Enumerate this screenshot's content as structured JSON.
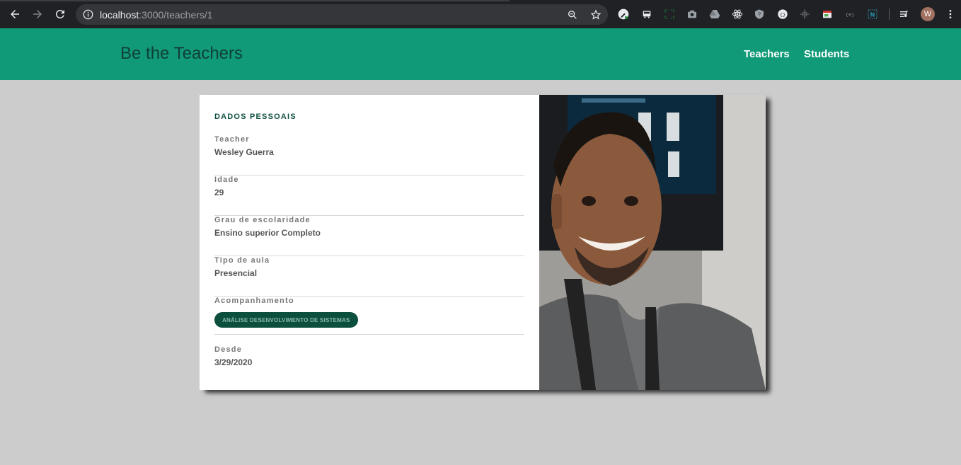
{
  "browser": {
    "url_host": "localhost",
    "url_path": ":3000/teachers/1",
    "profile_initial": "W"
  },
  "site": {
    "title": "Be the Teachers",
    "nav": [
      "Teachers",
      "Students"
    ]
  },
  "card": {
    "section_title": "DADOS PESSOAIS",
    "fields": [
      {
        "label": "Teacher",
        "value": "Wesley Guerra"
      },
      {
        "label": "Idade",
        "value": "29"
      },
      {
        "label": "Grau de escolaridade",
        "value": "Ensino superior Completo"
      },
      {
        "label": "Tipo de aula",
        "value": "Presencial"
      },
      {
        "label": "Acompanhamento",
        "chip": "ANÁLISE DESENVOLVIMENTO DE SISTEMAS"
      },
      {
        "label": "Desde",
        "value": "3/29/2020"
      }
    ]
  },
  "colors": {
    "header": "#119a78",
    "title": "#0f3f35",
    "chip_bg": "#0d4f3f",
    "page_bg": "#cccccc"
  }
}
